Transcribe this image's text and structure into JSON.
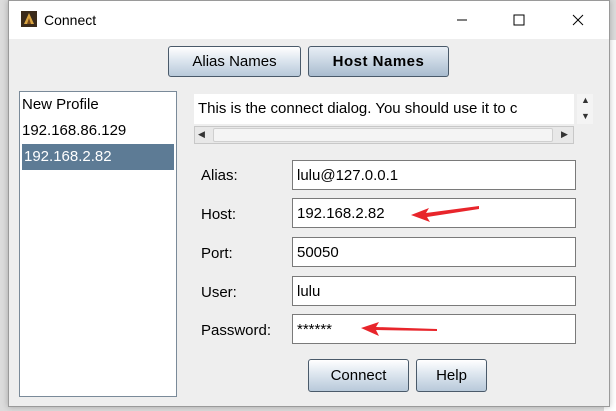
{
  "window": {
    "title": "Connect"
  },
  "tabs": [
    {
      "label": "Alias Names"
    },
    {
      "label": "Host Names"
    }
  ],
  "profiles": [
    {
      "label": "New Profile",
      "selected": false
    },
    {
      "label": "192.168.86.129",
      "selected": false
    },
    {
      "label": "192.168.2.82",
      "selected": true
    }
  ],
  "info_text": "This is the connect dialog. You should use it to c",
  "fields": {
    "alias": {
      "label": "Alias:",
      "value": "lulu@127.0.0.1"
    },
    "host": {
      "label": "Host:",
      "value": "192.168.2.82"
    },
    "port": {
      "label": "Port:",
      "value": "50050"
    },
    "user": {
      "label": "User:",
      "value": "lulu"
    },
    "password": {
      "label": "Password:",
      "value": "******"
    }
  },
  "buttons": {
    "connect": "Connect",
    "help": "Help"
  },
  "colors": {
    "selection": "#5d7b95",
    "annotation": "#e8252b"
  },
  "icons": [
    "app-icon",
    "minimize-icon",
    "maximize-icon",
    "close-icon"
  ]
}
